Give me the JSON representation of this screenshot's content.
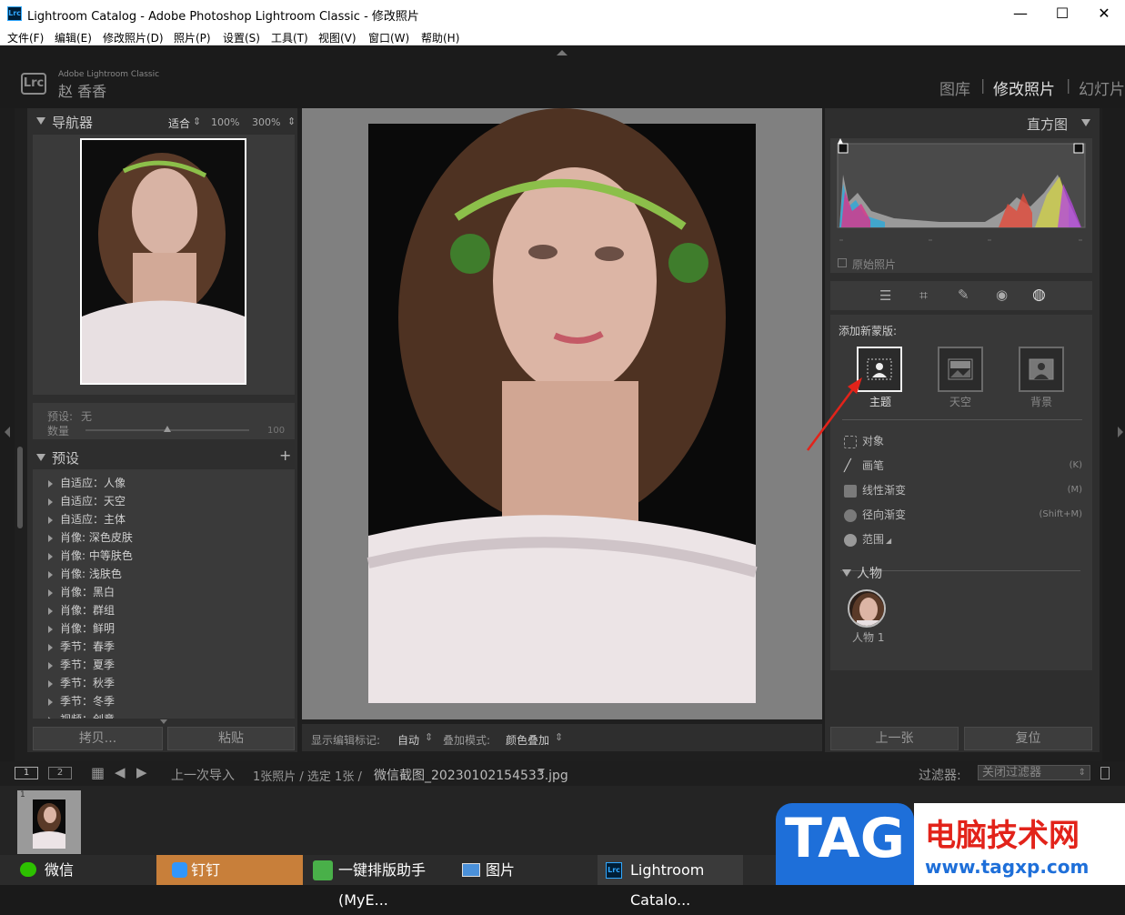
{
  "window": {
    "title": "Lightroom Catalog - Adobe Photoshop Lightroom Classic - 修改照片",
    "app_icon": "Lrc",
    "minimize": "—",
    "maximize": "☐",
    "close": "✕"
  },
  "menu": [
    "文件(F)",
    "编辑(E)",
    "修改照片(D)",
    "照片(P)",
    "设置(S)",
    "工具(T)",
    "视图(V)",
    "窗口(W)",
    "帮助(H)"
  ],
  "identity": {
    "badge": "Lrc",
    "product": "Adobe Lightroom Classic",
    "user": "赵 香香"
  },
  "modules": [
    "图库",
    "修改照片",
    "幻灯片"
  ],
  "navigator": {
    "title": "导航器",
    "zoom_options": [
      "适合",
      "100%",
      "300%"
    ]
  },
  "preset_amount": {
    "preset_label": "预设:",
    "preset_value": "无",
    "amount_label": "数量",
    "amount_value": "100",
    "amount_fraction": 0.5
  },
  "presets": {
    "title": "预设",
    "add": "+",
    "items": [
      "自适应：人像",
      "自适应：天空",
      "自适应：主体",
      "肖像: 深色皮肤",
      "肖像: 中等肤色",
      "肖像: 浅肤色",
      "肖像：黑白",
      "肖像：群组",
      "肖像：鲜明",
      "季节：春季",
      "季节：夏季",
      "季节：秋季",
      "季节：冬季",
      "视频：创意"
    ]
  },
  "left_buttons": {
    "copy": "拷贝...",
    "paste": "粘贴"
  },
  "toolbar": {
    "show_edit_label": "显示编辑标记:",
    "show_edit_value": "自动",
    "overlay_label": "叠加模式:",
    "overlay_value": "颜色叠加"
  },
  "histogram": {
    "title": "直方图",
    "original_photo": "原始照片"
  },
  "masking": {
    "add_new_mask": "添加新蒙版:",
    "types": [
      {
        "label": "主题",
        "selected": true
      },
      {
        "label": "天空",
        "selected": false
      },
      {
        "label": "背景",
        "selected": false
      }
    ],
    "tools": [
      {
        "label": "对象",
        "shortcut": ""
      },
      {
        "label": "画笔",
        "shortcut": "(K)"
      },
      {
        "label": "线性渐变",
        "shortcut": "(M)"
      },
      {
        "label": "径向渐变",
        "shortcut": "(Shift+M)"
      },
      {
        "label": "范围",
        "shortcut": ""
      }
    ],
    "people_section": "人物",
    "person": "人物 1"
  },
  "right_buttons": {
    "prev": "上一张",
    "reset": "复位"
  },
  "filmstrip": {
    "view1": "1",
    "view2": "2",
    "source": "上一次导入",
    "count": "1张照片 / 选定 1张 /",
    "filename": "微信截图_20230102154533.jpg",
    "filter_label": "过滤器:",
    "filter_value": "关闭过滤器",
    "thumb_index": "1"
  },
  "taskbar": [
    "微信",
    "钉钉",
    "一键排版助手(MyE...",
    "图片",
    "Lightroom Catalo..."
  ],
  "watermark": {
    "tag": "TAG",
    "site_name": "电脑技术网",
    "url": "www.tagxp.com"
  },
  "colors": {
    "accent_red": "#e2231a",
    "tag_blue": "#1e6fd9"
  }
}
